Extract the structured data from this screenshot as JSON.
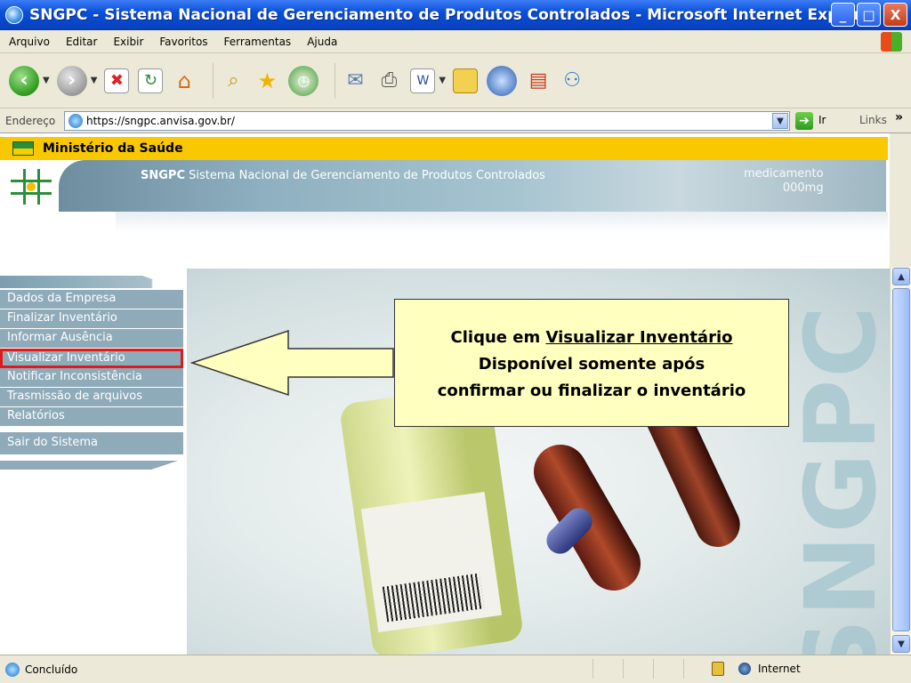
{
  "window": {
    "title": "SNGPC - Sistema Nacional de Gerenciamento de Produtos Controlados - Microsoft Internet Explorer",
    "min": "_",
    "max": "□",
    "close": "X"
  },
  "menubar": [
    "Arquivo",
    "Editar",
    "Exibir",
    "Favoritos",
    "Ferramentas",
    "Ajuda"
  ],
  "toolbar": {
    "back": "‹",
    "forward": "›"
  },
  "address": {
    "label": "Endereço",
    "url": "https://sngpc.anvisa.gov.br/",
    "go": "Ir",
    "links": "Links",
    "more": "»"
  },
  "page": {
    "ministry": "Ministério da Saúde",
    "banner_acronym": "SNGPC",
    "banner_title": "Sistema Nacional de Gerenciamento de Produtos Controlados",
    "banner_med_line1": "medicamento",
    "banner_med_line2": "000mg",
    "big_text": "SNGPC"
  },
  "menu": [
    "Dados da Empresa",
    "Finalizar Inventário",
    "Informar Ausência",
    "Visualizar Inventário",
    "Notificar Inconsistência",
    "Trasmissão de arquivos",
    "Relatórios",
    "Sair do Sistema"
  ],
  "callout": {
    "prefix": "Clique em ",
    "link": "Visualizar Inventário",
    "line2": "Disponível somente após",
    "line3": "confirmar ou finalizar o inventário"
  },
  "status": {
    "text": "Concluído",
    "zone": "Internet"
  }
}
